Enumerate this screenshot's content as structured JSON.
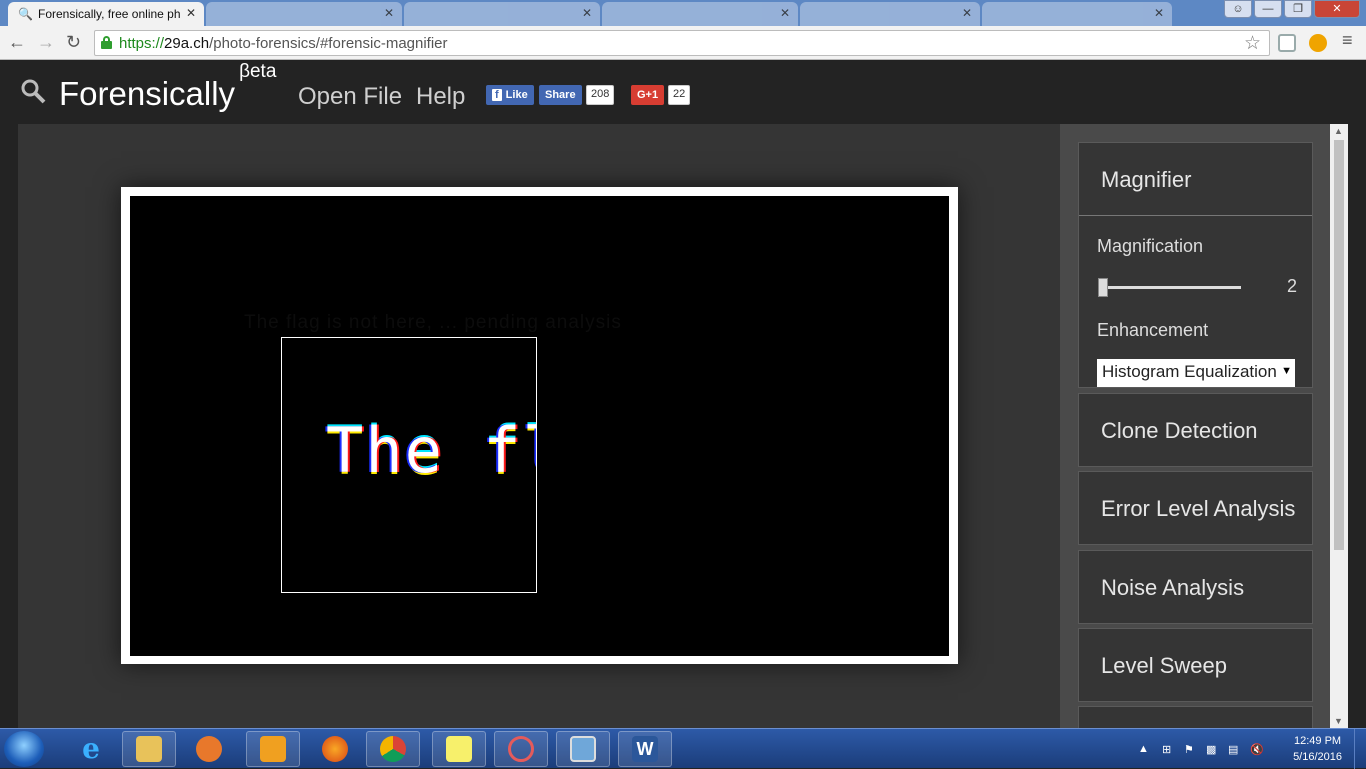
{
  "browser": {
    "tabs": [
      {
        "title": "Forensically, free online ph",
        "active": true
      },
      {
        "title": "",
        "active": false
      },
      {
        "title": "",
        "active": false
      },
      {
        "title": "",
        "active": false
      },
      {
        "title": "",
        "active": false
      },
      {
        "title": "",
        "active": false
      }
    ],
    "url": {
      "scheme": "https://",
      "host": "29a.ch",
      "path": "/photo-forensics/#forensic-magnifier"
    }
  },
  "header": {
    "brand": "Forensically",
    "beta": "βeta",
    "nav": [
      "Open File",
      "Help"
    ],
    "fb_like": "Like",
    "fb_share": "Share",
    "fb_count": "208",
    "gplus": "G+1",
    "gplus_count": "22"
  },
  "viewer": {
    "faint_text": "The flag is not here, ... pending analysis",
    "magnified_text": "The fla"
  },
  "sidebar": {
    "magnifier": {
      "title": "Magnifier",
      "magnification_label": "Magnification",
      "magnification_value": "2",
      "enhancement_label": "Enhancement",
      "enhancement_value": "Histogram Equalization"
    },
    "tools": [
      "Clone Detection",
      "Error Level Analysis",
      "Noise Analysis",
      "Level Sweep"
    ]
  },
  "taskbar": {
    "time": "12:49 PM",
    "date": "5/16/2016"
  }
}
